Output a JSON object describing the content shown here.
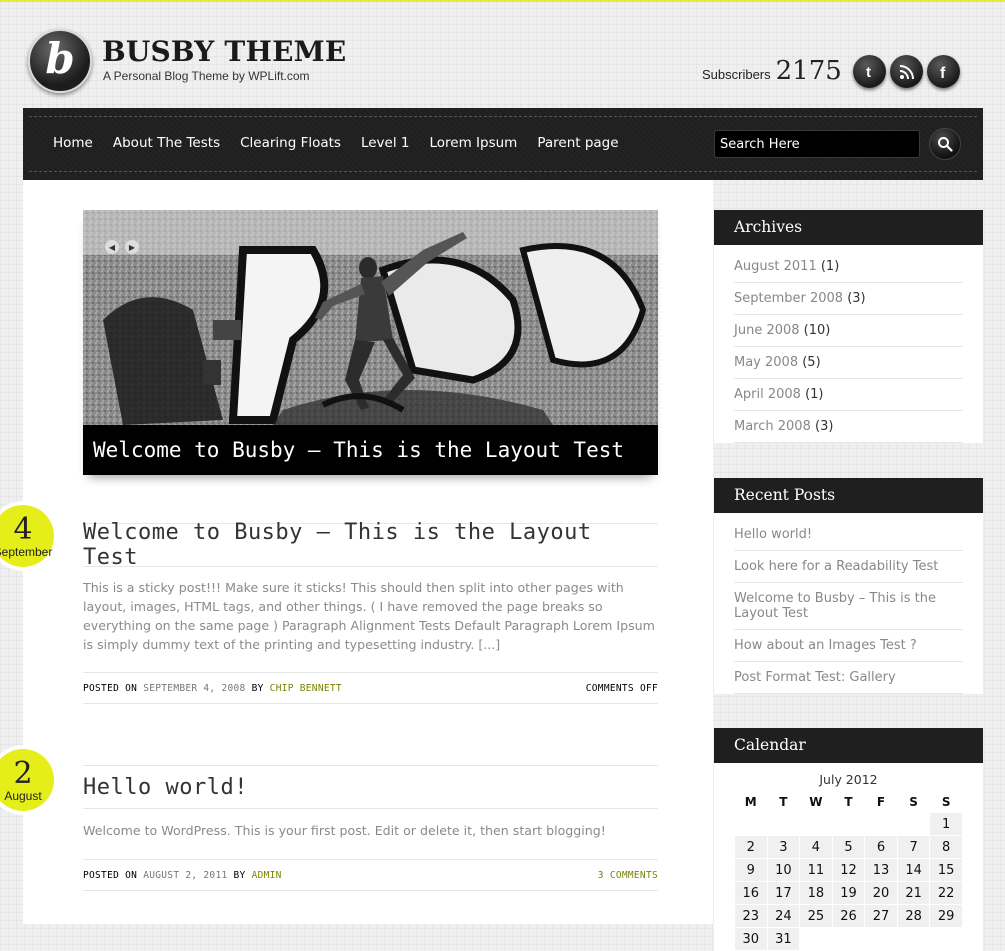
{
  "header": {
    "logo_letter": "b",
    "title": "BUSBY THEME",
    "tagline": "A Personal Blog Theme by WPLift.com",
    "subscribers_label": "Subscribers",
    "subscribers_count": "2175",
    "social": [
      {
        "name": "twitter-icon",
        "glyph": "t"
      },
      {
        "name": "rss-icon",
        "glyph": "rss"
      },
      {
        "name": "facebook-icon",
        "glyph": "f"
      }
    ]
  },
  "nav": {
    "items": [
      "Home",
      "About The Tests",
      "Clearing Floats",
      "Level 1",
      "Lorem Ipsum",
      "Parent page"
    ],
    "search_placeholder": "Search Here"
  },
  "slider": {
    "caption": "Welcome to Busby – This is the Layout Test"
  },
  "posts": [
    {
      "day": "4",
      "month": "September",
      "title": "Welcome to Busby – This is the Layout Test",
      "excerpt": "This is a sticky post!!! Make sure it sticks! This should then split into other pages with layout, images, HTML tags, and other things. ( I have removed the page breaks so everything on the same page ) Paragraph Alignment Tests Default Paragraph Lorem Ipsum is simply dummy text of the printing and typesetting industry. [...]",
      "posted_on_label": "POSTED ON",
      "date": "SEPTEMBER 4, 2008",
      "by_label": "BY",
      "author": "CHIP BENNETT",
      "comments": "COMMENTS OFF"
    },
    {
      "day": "2",
      "month": "August",
      "title": "Hello world!",
      "excerpt": "Welcome to WordPress. This is your first post. Edit or delete it, then start blogging!",
      "posted_on_label": "POSTED ON",
      "date": "AUGUST 2, 2011",
      "by_label": "BY",
      "author": "ADMIN",
      "comments": "3 COMMENTS"
    }
  ],
  "sidebar": {
    "archives": {
      "title": "Archives",
      "items": [
        {
          "label": "August 2011",
          "count": "(1)"
        },
        {
          "label": "September 2008",
          "count": "(3)"
        },
        {
          "label": "June 2008",
          "count": "(10)"
        },
        {
          "label": "May 2008",
          "count": "(5)"
        },
        {
          "label": "April 2008",
          "count": "(1)"
        },
        {
          "label": "March 2008",
          "count": "(3)"
        }
      ]
    },
    "recent_posts": {
      "title": "Recent Posts",
      "items": [
        "Hello world!",
        "Look here for a Readability Test",
        "Welcome to Busby – This is the Layout Test",
        "How about an Images Test ?",
        "Post Format Test: Gallery"
      ]
    },
    "calendar": {
      "title": "Calendar",
      "month": "July 2012",
      "weekdays": [
        "M",
        "T",
        "W",
        "T",
        "F",
        "S",
        "S"
      ],
      "weeks": [
        [
          "",
          "",
          "",
          "",
          "",
          "",
          "1"
        ],
        [
          "2",
          "3",
          "4",
          "5",
          "6",
          "7",
          "8"
        ],
        [
          "9",
          "10",
          "11",
          "12",
          "13",
          "14",
          "15"
        ],
        [
          "16",
          "17",
          "18",
          "19",
          "20",
          "21",
          "22"
        ],
        [
          "23",
          "24",
          "25",
          "26",
          "27",
          "28",
          "29"
        ],
        [
          "30",
          "31",
          "",
          "",
          "",
          "",
          ""
        ]
      ]
    }
  },
  "colors": {
    "accent_yellow": "#e6ee1a",
    "dark_bar": "#1f1f1f",
    "meta_link": "#7a8300"
  }
}
